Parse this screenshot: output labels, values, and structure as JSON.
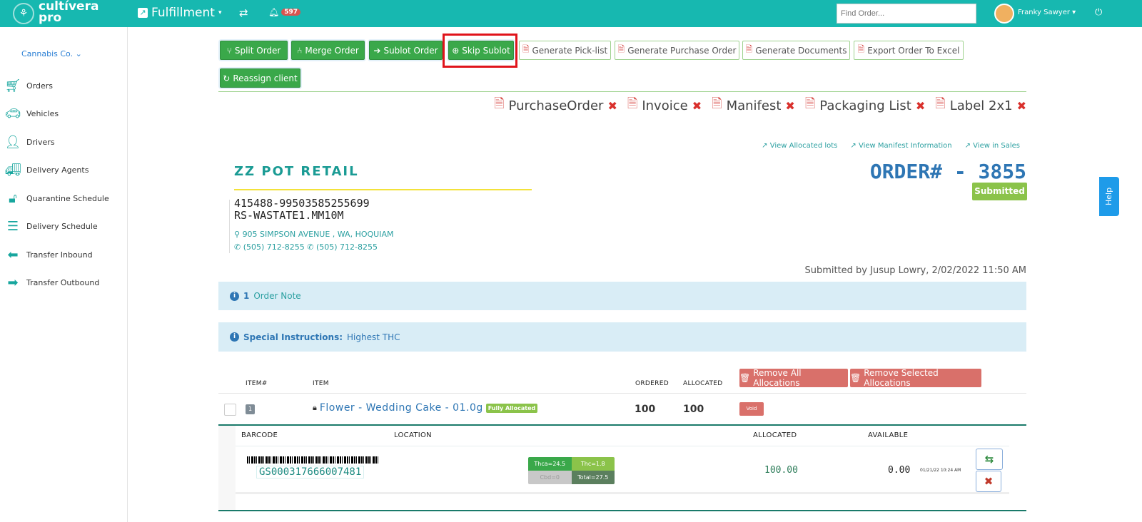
{
  "header": {
    "logo_line1": "cultívera",
    "logo_line2": "pro",
    "module": "Fulfillment",
    "notif_count": "597",
    "search_placeholder": "Find Order...",
    "user": "Franky Sawyer"
  },
  "sidebar": {
    "company": "Cannabis Co.",
    "items": [
      {
        "label": "Orders",
        "icon": "cart-icon"
      },
      {
        "label": "Vehicles",
        "icon": "car-icon"
      },
      {
        "label": "Drivers",
        "icon": "user-icon"
      },
      {
        "label": "Delivery Agents",
        "icon": "truck-icon"
      },
      {
        "label": "Quarantine Schedule",
        "icon": "unlock-icon"
      },
      {
        "label": "Delivery Schedule",
        "icon": "list-icon"
      },
      {
        "label": "Transfer Inbound",
        "icon": "arrow-left-icon"
      },
      {
        "label": "Transfer Outbound",
        "icon": "arrow-right-icon"
      }
    ]
  },
  "toolbar": {
    "split": "Split Order",
    "merge": "Merge Order",
    "sublot": "Sublot Order",
    "skip": "Skip Sublot",
    "picklist": "Generate Pick-list",
    "po": "Generate Purchase Order",
    "docs": "Generate Documents",
    "excel": "Export Order To Excel",
    "reassign": "Reassign client"
  },
  "documents": [
    "PurchaseOrder",
    "Invoice",
    "Manifest",
    "Packaging List",
    "Label 2x1"
  ],
  "links": {
    "lots": "View Allocated lots",
    "manifest": "View Manifest Information",
    "sales": "View in Sales"
  },
  "customer": {
    "name": "ZZ POT RETAIL",
    "id": "415488-99503585255699",
    "license": "RS-WASTATE1.MM10M",
    "address": "905 SIMPSON AVENUE , WA, HOQUIAM",
    "phone1": "(505) 712-8255",
    "phone2": "(505) 712-8255"
  },
  "order": {
    "number": "ORDER# - 3855",
    "status": "Submitted",
    "submitted_by": "Submitted by Jusup Lowry, 2/02/2022 11:50 AM"
  },
  "notes": {
    "count": "1",
    "label": "Order Note",
    "special_label": "Special Instructions:",
    "special_value": "Highest THC"
  },
  "table": {
    "headers": {
      "itemno": "ITEM#",
      "item": "ITEM",
      "ordered": "ORDERED",
      "allocated": "ALLOCATED"
    },
    "remove_all": "Remove All Allocations",
    "remove_selected": "Remove Selected Allocations",
    "row": {
      "num": "1",
      "name": "Flower - Wedding Cake - 01.0g",
      "badge": "Fully Allocated",
      "ordered": "100",
      "allocated": "100",
      "void": "Void"
    },
    "sub": {
      "headers": {
        "barcode": "BARCODE",
        "location": "LOCATION",
        "allocated": "ALLOCATED",
        "available": "AVAILABLE"
      },
      "barcode": "GS000317666007481",
      "thca": "Thca=24.5",
      "thc": "Thc=1.8",
      "cbd": "Cbd=0",
      "total": "Total=27.5",
      "allocated": "100.00",
      "available": "0.00",
      "date": "01/21/22 10:24 AM"
    }
  },
  "help": "Help"
}
